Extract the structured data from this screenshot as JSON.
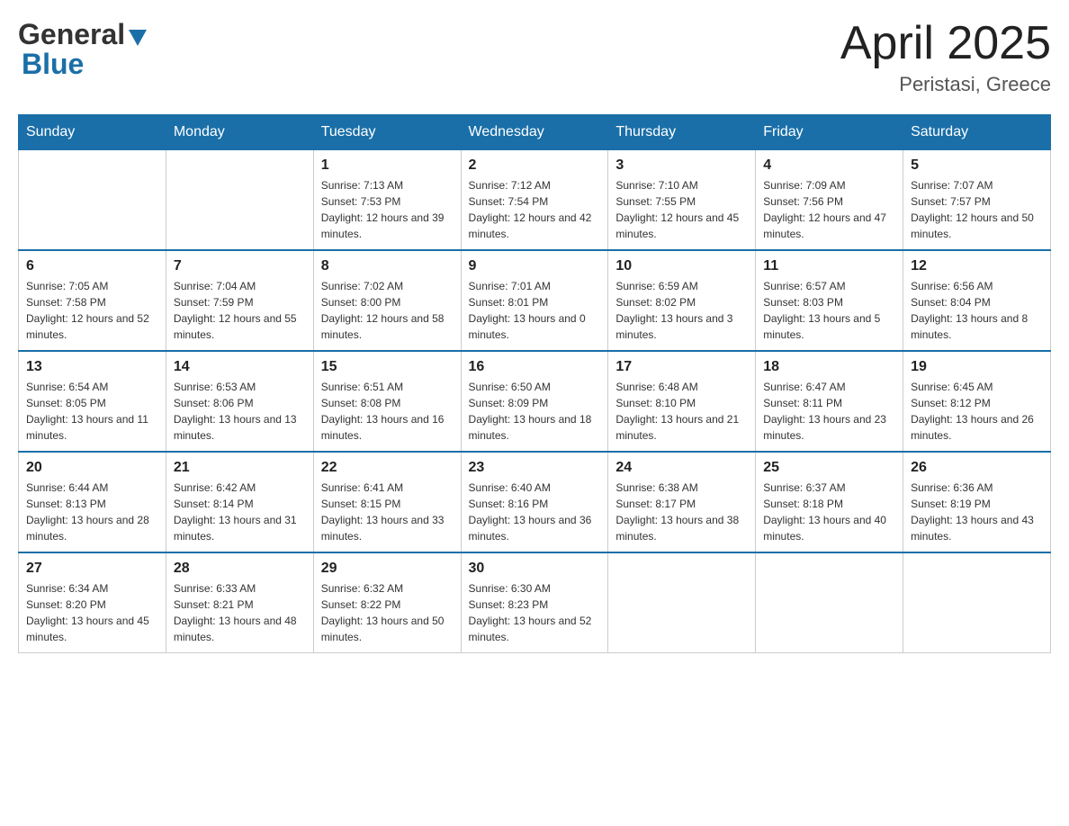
{
  "header": {
    "logo_general": "General",
    "logo_blue": "Blue",
    "month_title": "April 2025",
    "location": "Peristasi, Greece"
  },
  "weekdays": [
    "Sunday",
    "Monday",
    "Tuesday",
    "Wednesday",
    "Thursday",
    "Friday",
    "Saturday"
  ],
  "weeks": [
    [
      {
        "day": "",
        "sunrise": "",
        "sunset": "",
        "daylight": ""
      },
      {
        "day": "",
        "sunrise": "",
        "sunset": "",
        "daylight": ""
      },
      {
        "day": "1",
        "sunrise": "Sunrise: 7:13 AM",
        "sunset": "Sunset: 7:53 PM",
        "daylight": "Daylight: 12 hours and 39 minutes."
      },
      {
        "day": "2",
        "sunrise": "Sunrise: 7:12 AM",
        "sunset": "Sunset: 7:54 PM",
        "daylight": "Daylight: 12 hours and 42 minutes."
      },
      {
        "day": "3",
        "sunrise": "Sunrise: 7:10 AM",
        "sunset": "Sunset: 7:55 PM",
        "daylight": "Daylight: 12 hours and 45 minutes."
      },
      {
        "day": "4",
        "sunrise": "Sunrise: 7:09 AM",
        "sunset": "Sunset: 7:56 PM",
        "daylight": "Daylight: 12 hours and 47 minutes."
      },
      {
        "day": "5",
        "sunrise": "Sunrise: 7:07 AM",
        "sunset": "Sunset: 7:57 PM",
        "daylight": "Daylight: 12 hours and 50 minutes."
      }
    ],
    [
      {
        "day": "6",
        "sunrise": "Sunrise: 7:05 AM",
        "sunset": "Sunset: 7:58 PM",
        "daylight": "Daylight: 12 hours and 52 minutes."
      },
      {
        "day": "7",
        "sunrise": "Sunrise: 7:04 AM",
        "sunset": "Sunset: 7:59 PM",
        "daylight": "Daylight: 12 hours and 55 minutes."
      },
      {
        "day": "8",
        "sunrise": "Sunrise: 7:02 AM",
        "sunset": "Sunset: 8:00 PM",
        "daylight": "Daylight: 12 hours and 58 minutes."
      },
      {
        "day": "9",
        "sunrise": "Sunrise: 7:01 AM",
        "sunset": "Sunset: 8:01 PM",
        "daylight": "Daylight: 13 hours and 0 minutes."
      },
      {
        "day": "10",
        "sunrise": "Sunrise: 6:59 AM",
        "sunset": "Sunset: 8:02 PM",
        "daylight": "Daylight: 13 hours and 3 minutes."
      },
      {
        "day": "11",
        "sunrise": "Sunrise: 6:57 AM",
        "sunset": "Sunset: 8:03 PM",
        "daylight": "Daylight: 13 hours and 5 minutes."
      },
      {
        "day": "12",
        "sunrise": "Sunrise: 6:56 AM",
        "sunset": "Sunset: 8:04 PM",
        "daylight": "Daylight: 13 hours and 8 minutes."
      }
    ],
    [
      {
        "day": "13",
        "sunrise": "Sunrise: 6:54 AM",
        "sunset": "Sunset: 8:05 PM",
        "daylight": "Daylight: 13 hours and 11 minutes."
      },
      {
        "day": "14",
        "sunrise": "Sunrise: 6:53 AM",
        "sunset": "Sunset: 8:06 PM",
        "daylight": "Daylight: 13 hours and 13 minutes."
      },
      {
        "day": "15",
        "sunrise": "Sunrise: 6:51 AM",
        "sunset": "Sunset: 8:08 PM",
        "daylight": "Daylight: 13 hours and 16 minutes."
      },
      {
        "day": "16",
        "sunrise": "Sunrise: 6:50 AM",
        "sunset": "Sunset: 8:09 PM",
        "daylight": "Daylight: 13 hours and 18 minutes."
      },
      {
        "day": "17",
        "sunrise": "Sunrise: 6:48 AM",
        "sunset": "Sunset: 8:10 PM",
        "daylight": "Daylight: 13 hours and 21 minutes."
      },
      {
        "day": "18",
        "sunrise": "Sunrise: 6:47 AM",
        "sunset": "Sunset: 8:11 PM",
        "daylight": "Daylight: 13 hours and 23 minutes."
      },
      {
        "day": "19",
        "sunrise": "Sunrise: 6:45 AM",
        "sunset": "Sunset: 8:12 PM",
        "daylight": "Daylight: 13 hours and 26 minutes."
      }
    ],
    [
      {
        "day": "20",
        "sunrise": "Sunrise: 6:44 AM",
        "sunset": "Sunset: 8:13 PM",
        "daylight": "Daylight: 13 hours and 28 minutes."
      },
      {
        "day": "21",
        "sunrise": "Sunrise: 6:42 AM",
        "sunset": "Sunset: 8:14 PM",
        "daylight": "Daylight: 13 hours and 31 minutes."
      },
      {
        "day": "22",
        "sunrise": "Sunrise: 6:41 AM",
        "sunset": "Sunset: 8:15 PM",
        "daylight": "Daylight: 13 hours and 33 minutes."
      },
      {
        "day": "23",
        "sunrise": "Sunrise: 6:40 AM",
        "sunset": "Sunset: 8:16 PM",
        "daylight": "Daylight: 13 hours and 36 minutes."
      },
      {
        "day": "24",
        "sunrise": "Sunrise: 6:38 AM",
        "sunset": "Sunset: 8:17 PM",
        "daylight": "Daylight: 13 hours and 38 minutes."
      },
      {
        "day": "25",
        "sunrise": "Sunrise: 6:37 AM",
        "sunset": "Sunset: 8:18 PM",
        "daylight": "Daylight: 13 hours and 40 minutes."
      },
      {
        "day": "26",
        "sunrise": "Sunrise: 6:36 AM",
        "sunset": "Sunset: 8:19 PM",
        "daylight": "Daylight: 13 hours and 43 minutes."
      }
    ],
    [
      {
        "day": "27",
        "sunrise": "Sunrise: 6:34 AM",
        "sunset": "Sunset: 8:20 PM",
        "daylight": "Daylight: 13 hours and 45 minutes."
      },
      {
        "day": "28",
        "sunrise": "Sunrise: 6:33 AM",
        "sunset": "Sunset: 8:21 PM",
        "daylight": "Daylight: 13 hours and 48 minutes."
      },
      {
        "day": "29",
        "sunrise": "Sunrise: 6:32 AM",
        "sunset": "Sunset: 8:22 PM",
        "daylight": "Daylight: 13 hours and 50 minutes."
      },
      {
        "day": "30",
        "sunrise": "Sunrise: 6:30 AM",
        "sunset": "Sunset: 8:23 PM",
        "daylight": "Daylight: 13 hours and 52 minutes."
      },
      {
        "day": "",
        "sunrise": "",
        "sunset": "",
        "daylight": ""
      },
      {
        "day": "",
        "sunrise": "",
        "sunset": "",
        "daylight": ""
      },
      {
        "day": "",
        "sunrise": "",
        "sunset": "",
        "daylight": ""
      }
    ]
  ]
}
